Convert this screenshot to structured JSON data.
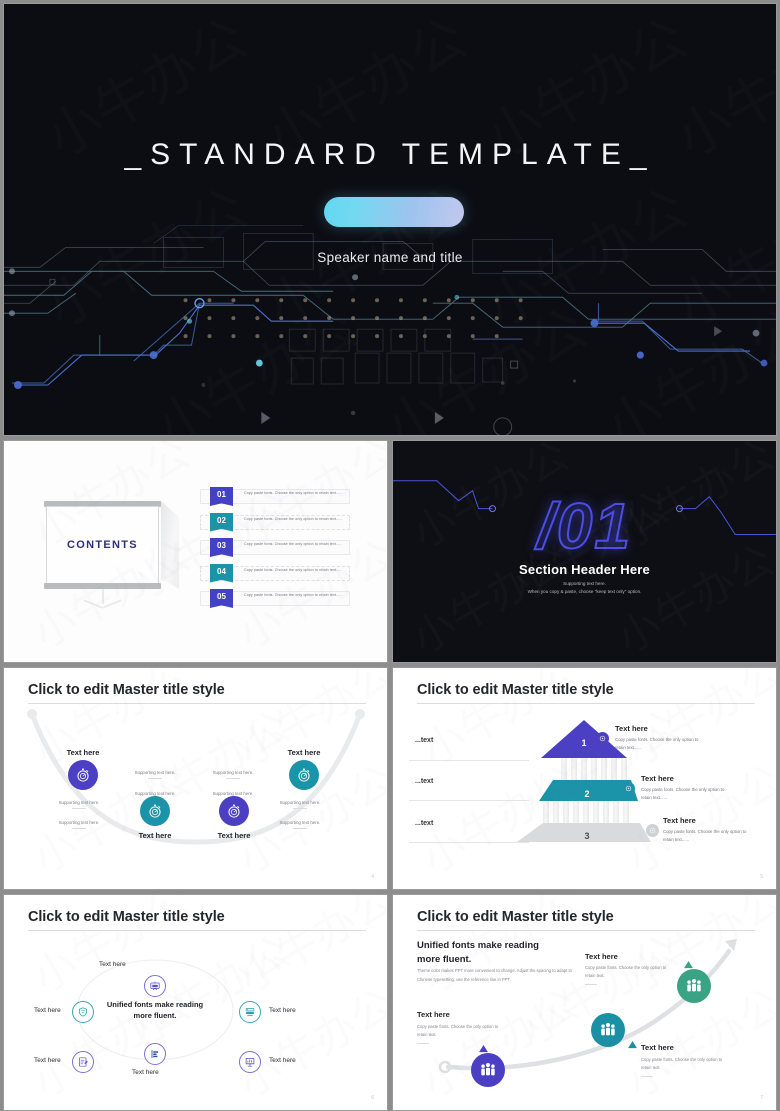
{
  "deck": {
    "title_slide": {
      "title": "_STANDARD TEMPLATE_",
      "subtitle": "Speaker name and title",
      "pill": "",
      "bg_color": "#0c0d13",
      "accent_cyan": "#63d6f2",
      "accent_lavender": "#c2c8ee"
    },
    "contents_slide": {
      "screen_label": "CONTENTS",
      "items": [
        {
          "num": "01",
          "color": "#4341c4",
          "text": "Copy paste fonts. Choose the only option to retain text......"
        },
        {
          "num": "02",
          "color": "#1b93a8",
          "text": "Copy paste fonts. Choose the only option to retain text......"
        },
        {
          "num": "03",
          "color": "#4341c4",
          "text": "Copy paste fonts. Choose the only option to retain text......"
        },
        {
          "num": "04",
          "color": "#1b93a8",
          "text": "Copy paste fonts. Choose the only option to retain text......"
        },
        {
          "num": "05",
          "color": "#4341c4",
          "text": "Copy paste fonts. Choose the only option to retain text......"
        }
      ]
    },
    "section_slide": {
      "number": "/01",
      "header": "Section Header Here",
      "support_line1": "Supporting text here.",
      "support_line2": "When you copy & paste, choose \"keep text only\" option.",
      "accent": "#4b4de6"
    },
    "timeline_slide": {
      "title": "Click to edit Master title style",
      "page": "4",
      "nodes": [
        {
          "label": "Text here",
          "color": "#4b3fc4",
          "icon": "stopwatch-icon"
        },
        {
          "label": "Text here",
          "color": "#1b93a8",
          "icon": "stopwatch-icon"
        },
        {
          "label": "Text here",
          "color": "#4b3fc4",
          "icon": "stopwatch-icon"
        },
        {
          "label": "Text here",
          "color": "#1b93a8",
          "icon": "stopwatch-icon"
        }
      ],
      "support": [
        "Supporting text here.",
        "Supporting text here.",
        "Supporting text here.",
        "Supporting text here.",
        "Supporting text here.",
        "Supporting text here.",
        "Supporting text here.",
        "Supporting text here."
      ]
    },
    "pyramid_slide": {
      "title": "Click to edit Master title style",
      "page": "5",
      "side_labels": [
        "...text",
        "...text",
        "...text"
      ],
      "levels": [
        {
          "num": "1",
          "color": "#4b3fc4",
          "head": "Text here",
          "body": "Copy paste fonts. Choose the only option to retain text......"
        },
        {
          "num": "2",
          "color": "#1b93a8",
          "head": "Text here",
          "body": "Copy paste fonts. Choose the only option to retain text......"
        },
        {
          "num": "3",
          "color": "#d6d7d9",
          "head": "Text here",
          "body": "Copy paste fonts. Choose the only option to retain text......"
        }
      ]
    },
    "circle_slide": {
      "title": "Click to edit Master title style",
      "page": "6",
      "center": "Unified fonts make reading more fluent.",
      "nodes": [
        {
          "label": "Text here",
          "icon": "presentation-board-icon",
          "color": "#5a4ec9"
        },
        {
          "label": "Text here",
          "icon": "server-stack-icon",
          "color": "#2f9fb2"
        },
        {
          "label": "Text here",
          "icon": "monitor-chart-icon",
          "color": "#5a4ec9"
        },
        {
          "label": "Text here",
          "icon": "bar-chart-doc-icon",
          "color": "#2a4f9e"
        },
        {
          "label": "Text here",
          "icon": "edit-document-icon",
          "color": "#5a4ec9"
        },
        {
          "label": "Text here",
          "icon": "shield-badge-icon",
          "color": "#2f9fb2"
        }
      ]
    },
    "growth_slide": {
      "title": "Click to edit Master title style",
      "page": "7",
      "lead": "Unified fonts make reading more fluent.",
      "paragraph": "Theme color makes PPT more convenient to change. Adjust the spacing to adapt to Chinese typesetting, use the reference line in PPT.",
      "steps": [
        {
          "head": "Text here",
          "body": "Copy paste fonts. Choose the only option to retain text.",
          "color": "#4b3fc4",
          "icon": "people-group-icon"
        },
        {
          "head": "Text here",
          "body": "Copy paste fonts. Choose the only option to retain text.",
          "color": "#1b8fa3",
          "icon": "people-group-icon"
        },
        {
          "head": "Text here",
          "body": "Copy paste fonts. Choose the only option to retain text.",
          "color": "#3aa384",
          "icon": "people-group-icon"
        }
      ]
    },
    "watermark": {
      "text": "小牛办公"
    }
  }
}
